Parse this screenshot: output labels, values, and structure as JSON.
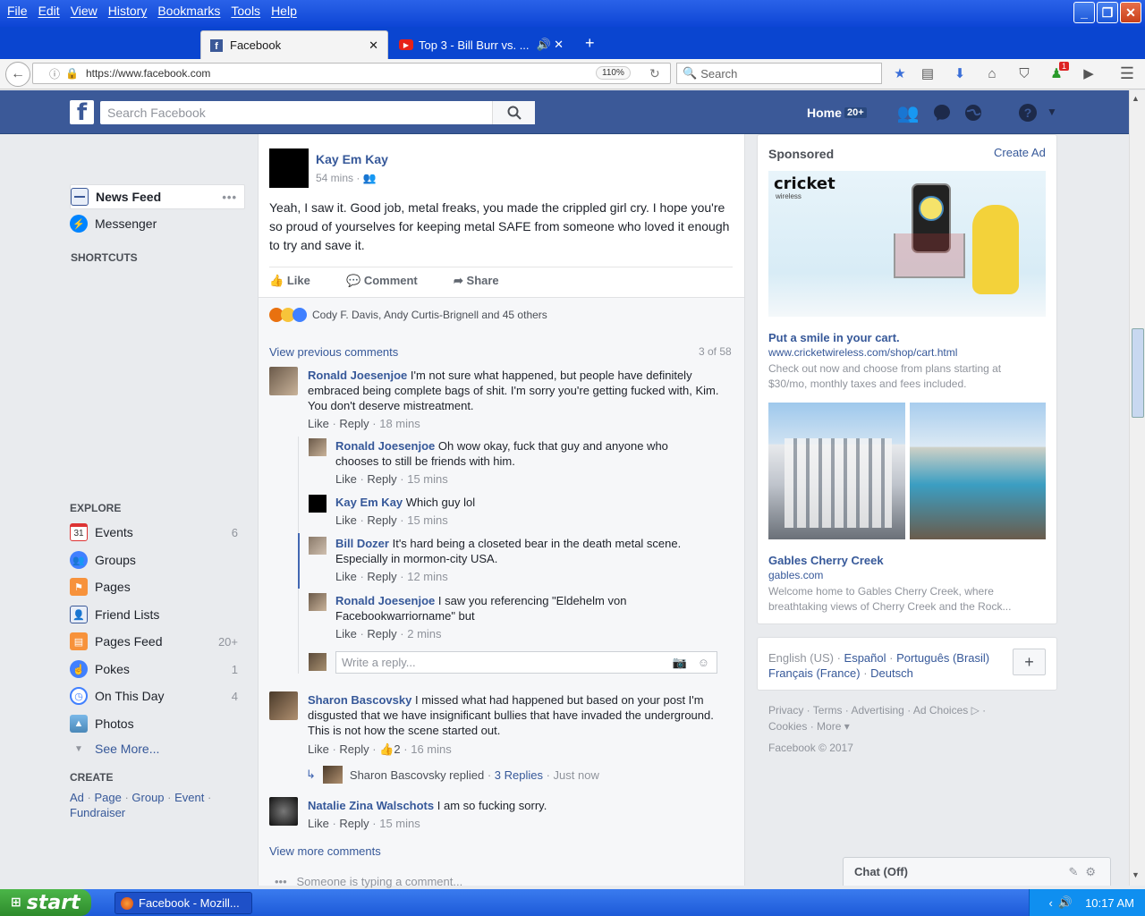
{
  "menu": [
    "File",
    "Edit",
    "View",
    "History",
    "Bookmarks",
    "Tools",
    "Help"
  ],
  "tabs": [
    {
      "label": "Facebook"
    },
    {
      "label": "Top 3 - Bill Burr vs. ..."
    }
  ],
  "url": "https://www.facebook.com",
  "zoom": "110%",
  "browser_search_placeholder": "Search",
  "notif_count": "1",
  "fb": {
    "search_placeholder": "Search Facebook",
    "home": "Home",
    "home_badge": "20+"
  },
  "left": {
    "news_feed": "News Feed",
    "messenger": "Messenger",
    "shortcuts": "SHORTCUTS",
    "explore": "EXPLORE",
    "items": [
      {
        "label": "Events",
        "count": "6"
      },
      {
        "label": "Groups",
        "count": ""
      },
      {
        "label": "Pages",
        "count": ""
      },
      {
        "label": "Friend Lists",
        "count": ""
      },
      {
        "label": "Pages Feed",
        "count": "20+"
      },
      {
        "label": "Pokes",
        "count": "1"
      },
      {
        "label": "On This Day",
        "count": "4"
      },
      {
        "label": "Photos",
        "count": ""
      }
    ],
    "see_more": "See More...",
    "create": "CREATE",
    "create_links": [
      "Ad",
      "Page",
      "Group",
      "Event",
      "Fundraiser"
    ],
    "events_day": "31"
  },
  "post": {
    "author": "Kay Em Kay",
    "time": "54 mins",
    "text": "Yeah, I saw it. Good job, metal freaks, you made the crippled girl cry. I hope you're so proud of yourselves for keeping metal SAFE from someone who loved it enough to try and save it.",
    "like": "Like",
    "comment": "Comment",
    "share": "Share",
    "reactions": "Cody F. Davis, Andy Curtis-Brignell and 45 others",
    "view_previous": "View previous comments",
    "count": "3 of 58",
    "view_more": "View more comments",
    "typing": "Someone is typing a comment...",
    "reply_placeholder": "Write a reply..."
  },
  "comments": [
    {
      "author": "Ronald Joesenjoe",
      "text": "I'm not sure what happened, but people have definitely embraced being complete bags of shit. I'm sorry you're getting fucked with, Kim. You don't deserve mistreatment.",
      "like": "Like",
      "reply": "Reply",
      "time": "18 mins"
    },
    {
      "author": "Ronald Joesenjoe",
      "text": "Oh wow okay, fuck that guy and anyone who chooses to still be friends with him.",
      "like": "Like",
      "reply": "Reply",
      "time": "15 mins"
    },
    {
      "author": "Kay Em Kay",
      "text": "Which guy lol",
      "like": "Like",
      "reply": "Reply",
      "time": "15 mins"
    },
    {
      "author": "Bill Dozer",
      "text": "It's hard being a closeted bear in the death metal scene. Especially in mormon-city USA.",
      "like": "Like",
      "reply": "Reply",
      "time": "12 mins"
    },
    {
      "author": "Ronald Joesenjoe",
      "text": "I saw you referencing \"Eldehelm von Facebookwarriorname\" but",
      "like": "Like",
      "reply": "Reply",
      "time": "2 mins"
    },
    {
      "author": "Sharon Bascovsky",
      "text": "I missed what had happened but based on your post I'm disgusted that we have insignificant bullies that have invaded the underground. This is not how the scene started out.",
      "like": "Like",
      "reply": "Reply",
      "likes": "2",
      "time": "16 mins"
    },
    {
      "author": "Natalie Zina Walschots",
      "text": "I am so fucking sorry.",
      "like": "Like",
      "reply": "Reply",
      "time": "15 mins"
    }
  ],
  "replied": {
    "text": "Sharon Bascovsky replied",
    "replies": "3 Replies",
    "time": "Just now"
  },
  "right": {
    "sponsored": "Sponsored",
    "create_ad": "Create Ad",
    "ad1": {
      "brand": "cricket",
      "brand_sub": "wireless",
      "title": "Put a smile in your cart.",
      "url": "www.cricketwireless.com/shop/cart.html",
      "desc": "Check out now and choose from plans starting at $30/mo, monthly taxes and fees included."
    },
    "ad2": {
      "title": "Gables Cherry Creek",
      "url": "gables.com",
      "desc": "Welcome home to Gables Cherry Creek, where breathtaking views of Cherry Creek and the Rock..."
    },
    "langs": [
      "English (US)",
      "Español",
      "Português (Brasil)",
      "Français (France)",
      "Deutsch"
    ],
    "footer": [
      "Privacy",
      "Terms",
      "Advertising",
      "Ad Choices",
      "Cookies",
      "More"
    ],
    "copyright": "Facebook © 2017",
    "chat": "Chat (Off)"
  },
  "taskbar": {
    "start": "start",
    "item": "Facebook - Mozill...",
    "clock": "10:17 AM"
  }
}
